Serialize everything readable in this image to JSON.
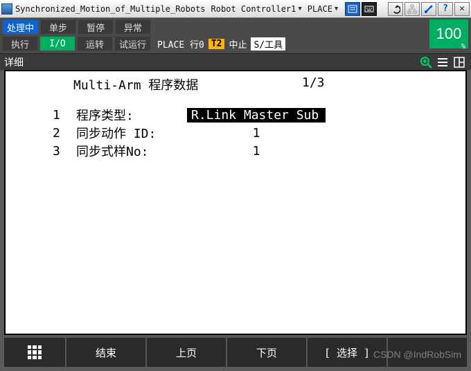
{
  "titlebar": {
    "app_title": "Synchronized_Motion_of_Multiple_Robots",
    "controller_label": "Robot Controller1",
    "program_label": "PLACE"
  },
  "status": {
    "row1": [
      "处理中",
      "单步",
      "暂停",
      "异常"
    ],
    "row2": [
      "执行",
      "I/O",
      "运转",
      "试运行"
    ],
    "line_prefix": "PLACE 行0",
    "t2": "T2",
    "halt": "中止",
    "tool_prefix": "S/工具",
    "percent": "100",
    "percent_suffix": "%"
  },
  "subheader": {
    "label": "详细"
  },
  "content": {
    "title": "Multi-Arm 程序数据",
    "page": "1/3",
    "rows": [
      {
        "n": "1",
        "label": "程序类型:",
        "value": "R.Link Master Sub",
        "hl": true
      },
      {
        "n": "2",
        "label": "同步动作 ID:",
        "value": "1",
        "hl": false
      },
      {
        "n": "3",
        "label": "同步式样No:",
        "value": "1",
        "hl": false
      }
    ]
  },
  "bottom": {
    "b1": "",
    "b2": "结束",
    "b3": "上页",
    "b4": "下页",
    "b5": "[ 选择 ]",
    "b6": ""
  },
  "watermark": "CSDN @IndRobSim"
}
